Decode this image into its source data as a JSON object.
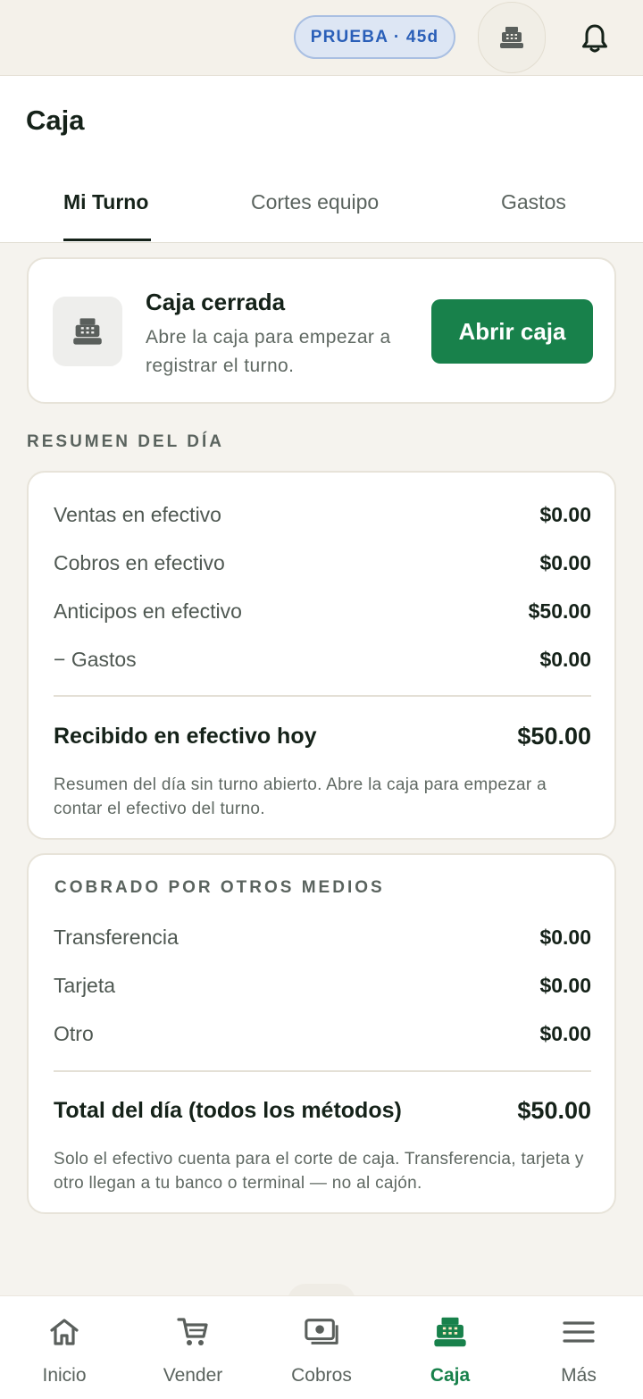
{
  "topbar": {
    "trial_badge": "PRUEBA · 45d",
    "register_icon": "cash-register-icon",
    "bell_icon": "bell-icon"
  },
  "header": {
    "title": "Caja",
    "tabs": [
      {
        "label": "Mi Turno",
        "active": true
      },
      {
        "label": "Cortes equipo",
        "active": false
      },
      {
        "label": "Gastos",
        "active": false
      }
    ]
  },
  "closed_card": {
    "icon": "cash-register-icon",
    "title": "Caja cerrada",
    "description": "Abre la caja para empezar a registrar el turno.",
    "button_label": "Abrir caja"
  },
  "summary": {
    "section_label": "RESUMEN DEL DÍA",
    "rows": [
      {
        "label": "Ventas en efectivo",
        "value": "$0.00"
      },
      {
        "label": "Cobros en efectivo",
        "value": "$0.00"
      },
      {
        "label": "Anticipos en efectivo",
        "value": "$50.00"
      },
      {
        "label": "− Gastos",
        "value": "$0.00"
      }
    ],
    "total_label": "Recibido en efectivo hoy",
    "total_value": "$50.00",
    "note": "Resumen del día sin turno abierto. Abre la caja para empezar a contar el efectivo del turno."
  },
  "other_methods": {
    "section_label": "COBRADO POR OTROS MEDIOS",
    "rows": [
      {
        "label": "Transferencia",
        "value": "$0.00"
      },
      {
        "label": "Tarjeta",
        "value": "$0.00"
      },
      {
        "label": "Otro",
        "value": "$0.00"
      }
    ],
    "total_label": "Total del día (todos los métodos)",
    "total_value": "$50.00",
    "note": "Solo el efectivo cuenta para el corte de caja. Transferencia, tarjeta y otro llegan a tu banco o terminal — no al cajón."
  },
  "bottom_nav": {
    "items": [
      {
        "label": "Inicio",
        "icon": "home-icon"
      },
      {
        "label": "Vender",
        "icon": "cart-icon"
      },
      {
        "label": "Cobros",
        "icon": "money-icon"
      },
      {
        "label": "Caja",
        "icon": "cash-register-icon",
        "active": true
      },
      {
        "label": "Más",
        "icon": "menu-icon"
      }
    ]
  },
  "colors": {
    "accent": "#18814b",
    "active_pill": "#fde9c3",
    "trial_badge_text": "#2a5fb8"
  }
}
